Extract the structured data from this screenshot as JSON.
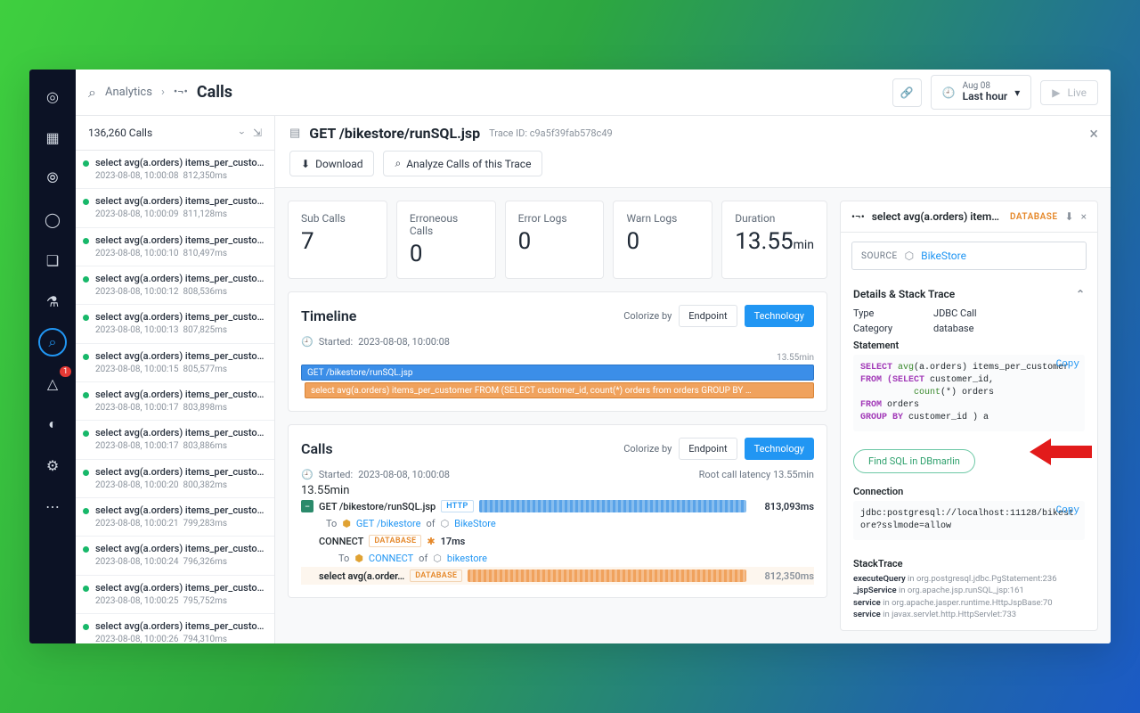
{
  "breadcrumb": {
    "root": "Analytics",
    "title": "Calls",
    "sep": "›"
  },
  "header": {
    "live": "Live",
    "time_top": "Aug 08",
    "time_bottom": "Last hour"
  },
  "calls_sidebar": {
    "count_label": "136,260 Calls",
    "item_title": "select avg(a.orders) items_per_custo…",
    "items": [
      {
        "ts": "2023-08-08, 10:00:08",
        "dur": "812,350ms"
      },
      {
        "ts": "2023-08-08, 10:00:09",
        "dur": "811,128ms"
      },
      {
        "ts": "2023-08-08, 10:00:10",
        "dur": "810,497ms"
      },
      {
        "ts": "2023-08-08, 10:00:12",
        "dur": "808,536ms"
      },
      {
        "ts": "2023-08-08, 10:00:13",
        "dur": "807,825ms"
      },
      {
        "ts": "2023-08-08, 10:00:15",
        "dur": "805,577ms"
      },
      {
        "ts": "2023-08-08, 10:00:17",
        "dur": "803,898ms"
      },
      {
        "ts": "2023-08-08, 10:00:17",
        "dur": "803,886ms"
      },
      {
        "ts": "2023-08-08, 10:00:20",
        "dur": "800,382ms"
      },
      {
        "ts": "2023-08-08, 10:00:21",
        "dur": "799,283ms"
      },
      {
        "ts": "2023-08-08, 10:00:24",
        "dur": "796,326ms"
      },
      {
        "ts": "2023-08-08, 10:00:25",
        "dur": "795,752ms"
      },
      {
        "ts": "2023-08-08, 10:00:26",
        "dur": "794,310ms"
      },
      {
        "ts": "",
        "dur": ""
      }
    ]
  },
  "trace": {
    "title": "GET /bikestore/runSQL.jsp",
    "trace_id_label": "Trace ID:",
    "trace_id": "c9a5f39fab578c49",
    "download": "Download",
    "analyze": "Analyze Calls of this Trace"
  },
  "stats": [
    {
      "label": "Sub Calls",
      "value": "7",
      "unit": ""
    },
    {
      "label": "Erroneous Calls",
      "value": "0",
      "unit": ""
    },
    {
      "label": "Error Logs",
      "value": "0",
      "unit": ""
    },
    {
      "label": "Warn Logs",
      "value": "0",
      "unit": ""
    },
    {
      "label": "Duration",
      "value": "13.55",
      "unit": "min"
    }
  ],
  "timeline": {
    "title": "Timeline",
    "colorize_label": "Colorize by",
    "endpoint": "Endpoint",
    "technology": "Technology",
    "started_label": "Started:",
    "started": "2023-08-08, 10:00:08",
    "duration": "13.55min",
    "bar1": "GET /bikestore/runSQL.jsp",
    "bar2": "select avg(a.orders) items_per_customer FROM (SELECT customer_id, count(*) orders from orders GROUP BY …"
  },
  "calls_panel": {
    "title": "Calls",
    "root_latency_label": "Root call latency",
    "root_latency": "13.55min",
    "rows": {
      "r1_name": "GET /bikestore/runSQL.jsp",
      "r1_ms": "813,093ms",
      "r1_to": "To",
      "r1_link": "GET /bikestore",
      "r1_of": "of",
      "r1_svc": "BikeStore",
      "r2_name": "CONNECT",
      "r2_ms": "17ms",
      "r2_link": "CONNECT",
      "r2_svc": "bikestore",
      "r3_name": "select avg(a.order…",
      "r3_ms": "812,350ms"
    },
    "http_tag": "HTTP",
    "db_tag": "DATABASE"
  },
  "detail": {
    "title": "select avg(a.orders) item…",
    "db_badge": "DATABASE",
    "source_label": "SOURCE",
    "source_value": "BikeStore",
    "section_title": "Details & Stack Trace",
    "type_k": "Type",
    "type_v": "JDBC Call",
    "cat_k": "Category",
    "cat_v": "database",
    "statement_label": "Statement",
    "copy": "Copy",
    "sql": {
      "l1a": "SELECT",
      "l1b": "avg",
      "l1c": "(a.orders) items_per_customer",
      "l2a": "FROM (SELECT",
      "l2b": " customer_id,",
      "l3a": "count",
      "l3b": "(*) orders",
      "l4a": "FROM",
      "l4b": " orders",
      "l5a": "GROUP BY",
      "l5b": " customer_id ) a"
    },
    "find_sql": "Find SQL in DBmarlin",
    "connection_label": "Connection",
    "connection": "jdbc:postgresql://localhost:11128/bikestore?sslmode=allow",
    "stacktrace_label": "StackTrace",
    "stack": [
      {
        "m": "executeQuery",
        "r": "in org.postgresql.jdbc.PgStatement:236"
      },
      {
        "m": "_jspService",
        "r": "in org.apache.jsp.runSQL_jsp:161"
      },
      {
        "m": "service",
        "r": "in org.apache.jasper.runtime.HttpJspBase:70"
      },
      {
        "m": "service",
        "r": "in javax.servlet.http.HttpServlet:733"
      }
    ]
  },
  "sidebar_badge": "1"
}
